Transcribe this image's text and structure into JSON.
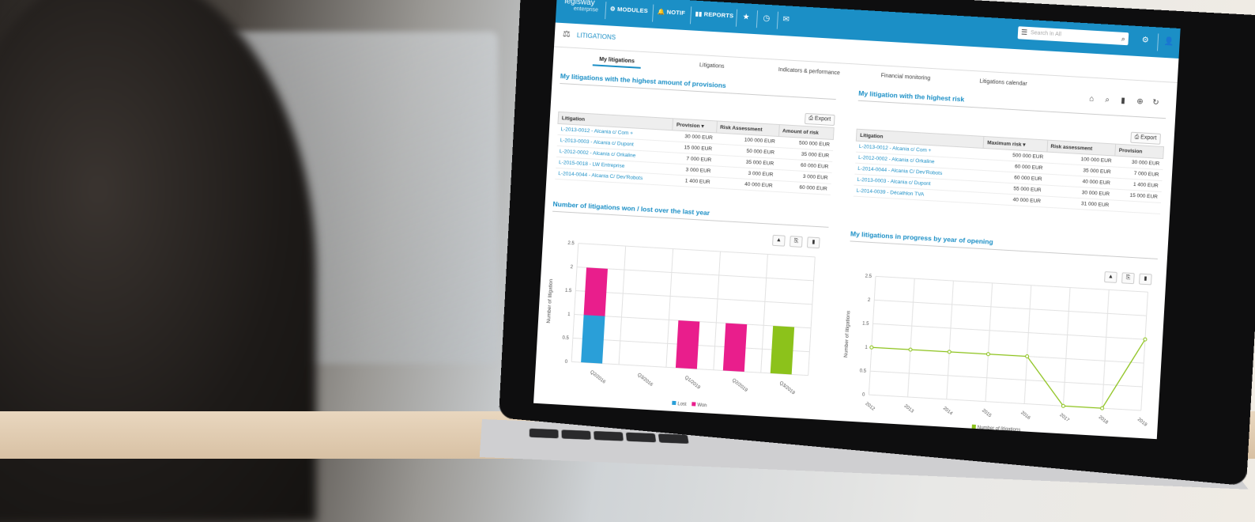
{
  "app": {
    "logo": "legisway",
    "logo_sub": "enterprise"
  },
  "nav": {
    "modules": "MODULES",
    "notif": "NOTIF",
    "reports": "REPORTS"
  },
  "search": {
    "placeholder": "Search in All"
  },
  "page": {
    "title": "LITIGATIONS"
  },
  "tabs": [
    "My litigations",
    "Litigations",
    "Indicators & performance",
    "Financial monitoring",
    "Litigations calendar"
  ],
  "provisions": {
    "title": "My litigations with the highest amount of provisions",
    "export": "Export",
    "columns": [
      "Litigation",
      "Provision ▾",
      "Risk Assessment",
      "Amount of risk"
    ],
    "rows": [
      [
        "L-2013-0012 - Alcania c/ Com +",
        "30 000 EUR",
        "100 000 EUR",
        "500 000 EUR"
      ],
      [
        "L-2013-0003 - Alcania c/ Dupont",
        "15 000 EUR",
        "50 000 EUR",
        "35 000 EUR"
      ],
      [
        "L-2012-0002 - Alcania c/ Orkaline",
        "7 000 EUR",
        "35 000 EUR",
        "60 000 EUR"
      ],
      [
        "L-2015-0018 - LW Entreprise",
        "3 000 EUR",
        "3 000 EUR",
        "3 000 EUR"
      ],
      [
        "L-2014-0044 - Alcania C/ Dev'Robots",
        "1 400 EUR",
        "40 000 EUR",
        "60 000 EUR"
      ]
    ]
  },
  "risk": {
    "title": "My litigation with the highest risk",
    "export": "Export",
    "columns": [
      "Litigation",
      "Maximum risk ▾",
      "Risk assessment",
      "Provision"
    ],
    "rows": [
      [
        "L-2013-0012 - Alcania c/ Com +",
        "500 000 EUR",
        "100 000 EUR",
        "30 000 EUR"
      ],
      [
        "L-2012-0002 - Alcania c/ Orkaline",
        "60 000 EUR",
        "35 000 EUR",
        "7 000 EUR"
      ],
      [
        "L-2014-0044 - Alcania C/ Dev'Robots",
        "60 000 EUR",
        "40 000 EUR",
        "1 400 EUR"
      ],
      [
        "L-2013-0003 - Alcania c/ Dupont",
        "55 000 EUR",
        "30 000 EUR",
        "15 000 EUR"
      ],
      [
        "L-2014-0039 - Décathlon TVA",
        "40 000 EUR",
        "31 000 EUR",
        ""
      ]
    ]
  },
  "chart_data": [
    {
      "type": "bar",
      "title": "Number of litigations won / lost over the last year",
      "ylabel": "Number of litigation",
      "ylim": [
        0,
        2.5
      ],
      "yticks": [
        "0",
        "0.5",
        "1",
        "1.5",
        "2",
        "2.5"
      ],
      "categories": [
        "Q2/2016",
        "Q3/2016",
        "Q1/2019",
        "Q2/2019",
        "Q3/2019"
      ],
      "series": [
        {
          "name": "Lost",
          "color": "#2a9fd8",
          "values": [
            1,
            0,
            0,
            0,
            0
          ]
        },
        {
          "name": "Won",
          "color": "#e91e8c",
          "values": [
            1,
            0,
            1,
            1,
            0
          ]
        },
        {
          "color": "#8cc21b",
          "values": [
            0,
            0,
            0,
            0,
            1
          ]
        }
      ]
    },
    {
      "type": "line",
      "title": "My litigations in progress by year of opening",
      "ylabel": "Number of litigations",
      "ylim": [
        0,
        2.5
      ],
      "yticks": [
        "0",
        "0.5",
        "1",
        "1.5",
        "2",
        "2.5"
      ],
      "x": [
        "2012",
        "2013",
        "2014",
        "2015",
        "2016",
        "2017",
        "2018",
        "2019"
      ],
      "series": [
        {
          "name": "Number of litigations",
          "color": "#8cc21b",
          "values": [
            1,
            1,
            1,
            1,
            1,
            0,
            0,
            1.5
          ]
        }
      ]
    }
  ]
}
